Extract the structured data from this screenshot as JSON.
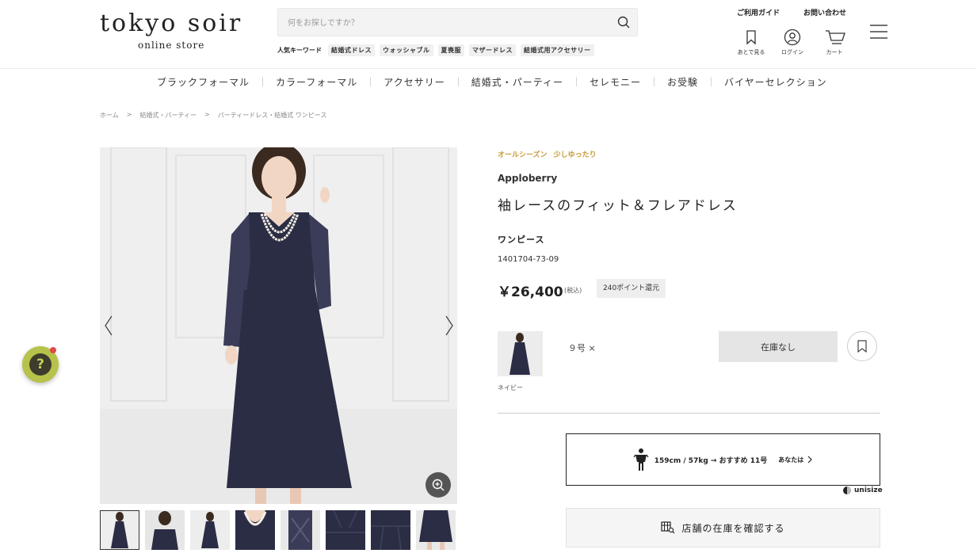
{
  "header": {
    "logo_main": "tokyo soir",
    "logo_sub": "online store",
    "search_placeholder": "何をお探しですか？",
    "keywords_title": "人気キーワード",
    "keywords": [
      "結婚式ドレス",
      "ウォッシャブル",
      "夏喪服",
      "マザードレス",
      "結婚式用アクセサリー"
    ],
    "guide_link": "ご利用ガイド",
    "contact_link": "お問い合わせ",
    "icons": [
      {
        "label": "あとで見る",
        "icon": "bookmark-icon"
      },
      {
        "label": "ログイン",
        "icon": "user-icon"
      },
      {
        "label": "カート",
        "icon": "cart-icon"
      }
    ]
  },
  "nav": [
    "ブラックフォーマル",
    "カラーフォーマル",
    "アクセサリー",
    "結婚式・パーティー",
    "セレモニー",
    "お受験",
    "バイヤーセレクション"
  ],
  "breadcrumb": [
    "ホーム",
    "結婚式・パーティー",
    "パーティードレス・結婚式 ワンピース"
  ],
  "breadcrumb_sep": ">",
  "product": {
    "tags": [
      "オールシーズン",
      "少しゆったり"
    ],
    "brand": "Apploberry",
    "name": "袖レースのフィット＆フレアドレス",
    "category": "ワンピース",
    "code": "1401704-73-09",
    "price": "￥26,400",
    "tax": "(税込)",
    "points": "240ポイント還元",
    "variant": {
      "color": "ネイビー",
      "size": "９号 ×",
      "stock_label": "在庫なし"
    },
    "size_recommend": {
      "main": "159cm / 57kg → おすすめ 11号",
      "you": "あなたは"
    },
    "unisize_label": "unisize",
    "store_button": "店舗の在庫を確認する"
  },
  "help_label": "?",
  "colors": {
    "navy_dress": "#2b2d45",
    "accent_gold": "#c89b3a",
    "help_green": "#b6c24a"
  }
}
